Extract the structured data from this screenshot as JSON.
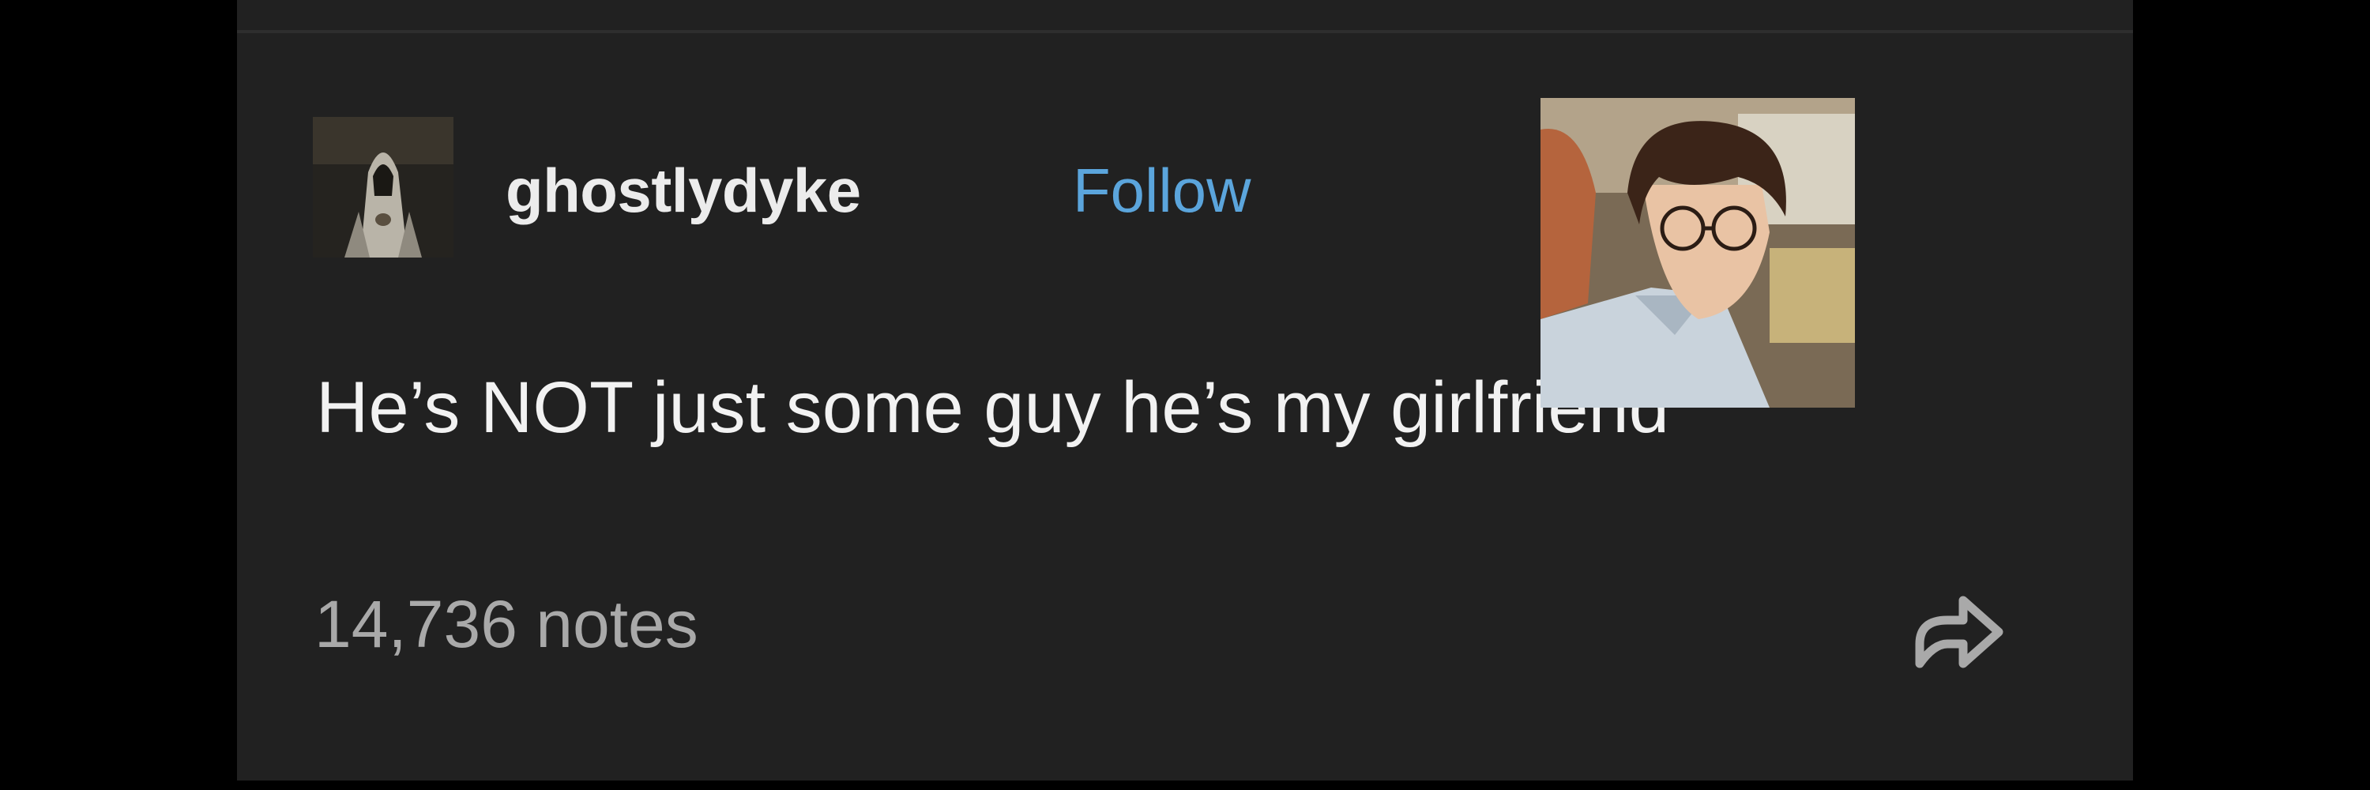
{
  "post": {
    "username": "ghostlydyke",
    "follow_label": "Follow",
    "body": "He’s NOT just some guy he’s my girlfriend",
    "notes": "14,736 notes"
  },
  "icons": {
    "avatar": "hooded-figure-avatar",
    "sticker": "cartoon-boy-with-glasses-image",
    "share": "share-arrow-icon"
  },
  "colors": {
    "background": "#212121",
    "username": "#ececec",
    "follow": "#5ba5dc",
    "notes": "#a9a9a9"
  }
}
